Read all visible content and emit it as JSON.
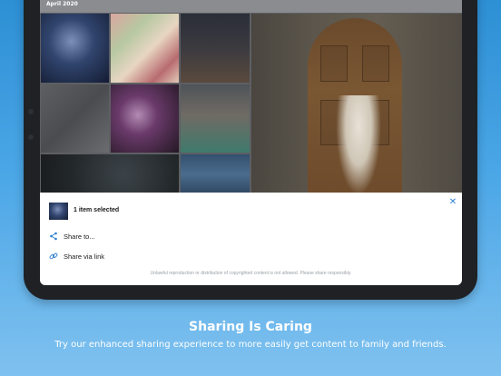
{
  "gallery": {
    "month_label": "April 2020"
  },
  "selection": {
    "count_label": "1 item selected"
  },
  "share_sheet": {
    "share_to_label": "Share to...",
    "share_link_label": "Share via link",
    "disclaimer": "Unlawful reproduction or distribution of copyrighted content is not allowed. Please share responsibly."
  },
  "promo": {
    "heading": "Sharing Is Caring",
    "subheading": "Try our enhanced sharing experience to more easily get content to family and friends."
  },
  "colors": {
    "background_top": "#2d8fd4",
    "background_bottom": "#7fc1ef",
    "accent": "#2d7fd0"
  },
  "icons": {
    "selected_check": "check-icon",
    "share": "share-icon",
    "link": "link-icon",
    "close": "close-icon"
  }
}
